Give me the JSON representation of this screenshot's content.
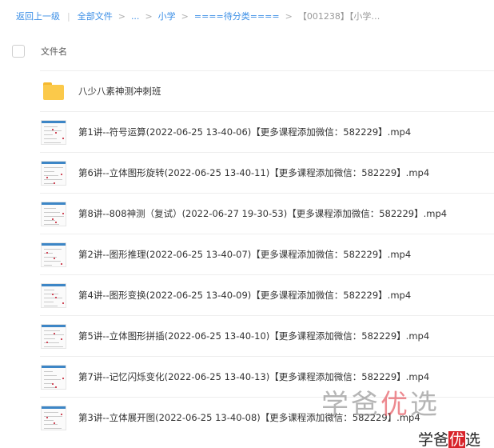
{
  "breadcrumb": {
    "back": "返回上一级",
    "all_files": "全部文件",
    "ellipsis": "...",
    "level1": "小学",
    "level2": "====待分类====",
    "current": "【001238】【小学…"
  },
  "header": {
    "column_name": "文件名"
  },
  "files": [
    {
      "type": "folder",
      "name": "八少八素神测冲刺班"
    },
    {
      "type": "video",
      "name": "第1讲--符号运算(2022-06-25 13-40-06)【更多课程添加微信：582229】.mp4"
    },
    {
      "type": "video",
      "name": "第6讲--立体图形旋转(2022-06-25 13-40-11)【更多课程添加微信：582229】.mp4"
    },
    {
      "type": "video",
      "name": "第8讲--808神测（复试）(2022-06-27 19-30-53)【更多课程添加微信：582229】.mp4"
    },
    {
      "type": "video",
      "name": "第2讲--图形推理(2022-06-25 13-40-07)【更多课程添加微信：582229】.mp4"
    },
    {
      "type": "video",
      "name": "第4讲--图形变换(2022-06-25 13-40-09)【更多课程添加微信：582229】.mp4"
    },
    {
      "type": "video",
      "name": "第5讲--立体图形拼插(2022-06-25 13-40-10)【更多课程添加微信：582229】.mp4"
    },
    {
      "type": "video",
      "name": "第7讲--记忆闪烁变化(2022-06-25 13-40-13)【更多课程添加微信：582229】.mp4"
    },
    {
      "type": "video",
      "name": "第3讲--立体展开图(2022-06-25 13-40-08)【更多课程添加微信：582229】.mp4"
    }
  ],
  "watermark": {
    "large_a": "学爸",
    "large_b": "优",
    "large_c": "选",
    "small_a": "学爸",
    "small_b": "优",
    "small_c": "选"
  },
  "icons": {
    "folder": "folder-icon",
    "video": "video-thumbnail-icon",
    "checkbox": "checkbox-icon"
  },
  "colors": {
    "link": "#3a8ee6",
    "folder": "#fbc94a",
    "watermark_accent": "#d8232a"
  }
}
